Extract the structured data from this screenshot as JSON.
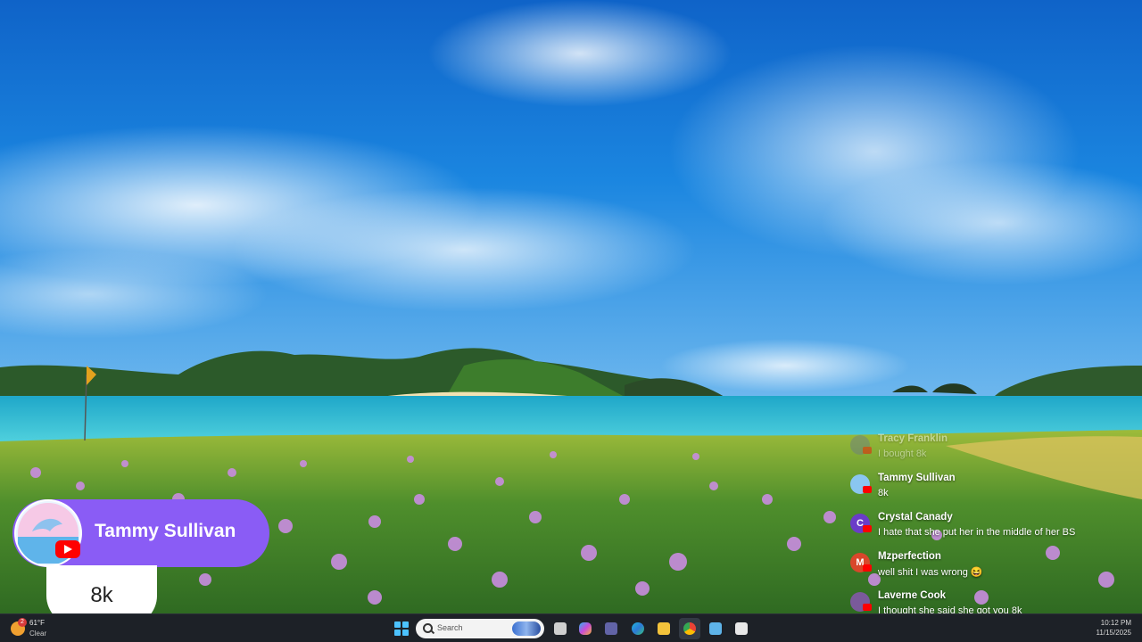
{
  "highlight": {
    "name": "Tammy Sullivan",
    "message": "8k"
  },
  "chat": [
    {
      "name": "Tracy Franklin",
      "text": "I bought 8k",
      "initial": "",
      "avatar_color": "#6a7a8a",
      "faded": true
    },
    {
      "name": "Tammy Sullivan",
      "text": "8k",
      "initial": "",
      "avatar_color": "#8ac6f0",
      "faded": false
    },
    {
      "name": "Crystal Canady",
      "text": "I hate that she put her in the middle of her BS",
      "initial": "C",
      "avatar_color": "#6a3cc8",
      "faded": false
    },
    {
      "name": "Mzperfection",
      "text": "well shit I was wrong 😆",
      "initial": "M",
      "avatar_color": "#d9472b",
      "faded": false
    },
    {
      "name": "Laverne Cook",
      "text": "I thought she said she got you 8k",
      "initial": "",
      "avatar_color": "#7a5a9a",
      "faded": false
    }
  ],
  "taskbar": {
    "weather_temp": "61°F",
    "weather_cond": "Clear",
    "weather_badge": "2",
    "search_placeholder": "Search",
    "time": "10:12 PM",
    "date": "11/15/2025"
  },
  "colors": {
    "accent_purple": "#8a5cf5",
    "youtube_red": "#ff0000",
    "taskbar_bg": "#1d2127"
  }
}
